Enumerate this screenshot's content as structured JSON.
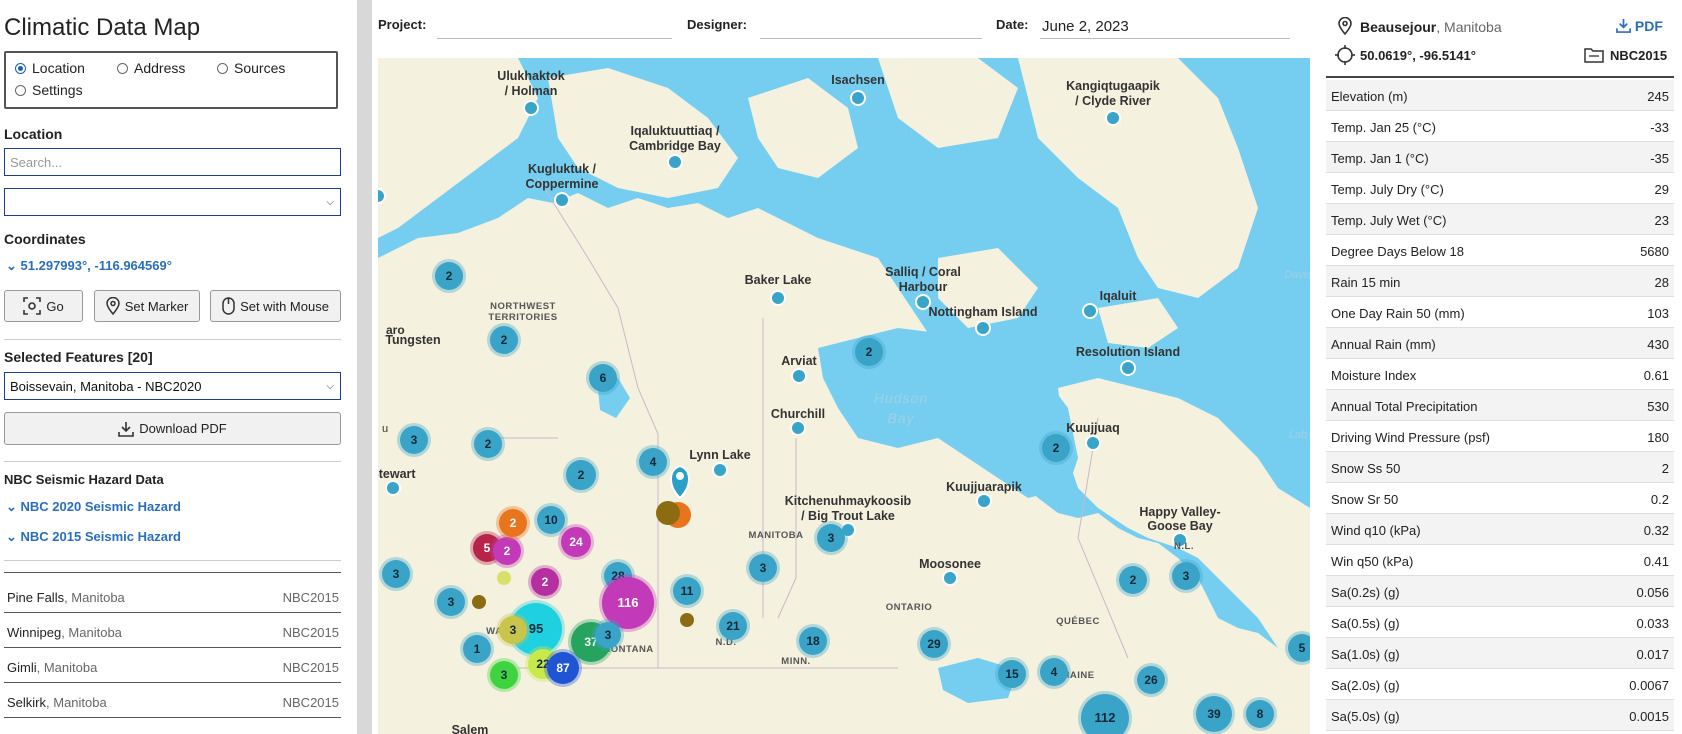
{
  "app_title": "Climatic Data Map",
  "modes": [
    {
      "label": "Location",
      "selected": true
    },
    {
      "label": "Address",
      "selected": false
    },
    {
      "label": "Sources",
      "selected": false
    },
    {
      "label": "Settings",
      "selected": false
    }
  ],
  "location_label": "Location",
  "search_placeholder": "Search...",
  "location_select_value": "",
  "coordinates_label": "Coordinates",
  "coordinates_value": "51.297993°, -116.964569°",
  "buttons": {
    "go": "Go",
    "set_marker": "Set Marker",
    "set_mouse": "Set with Mouse",
    "download_pdf": "Download PDF"
  },
  "selected_features_label": "Selected Features [20]",
  "selected_feature_value": "Boissevain, Manitoba - NBC2020",
  "seismic_label": "NBC Seismic Hazard Data",
  "seismic_links": [
    "NBC 2020 Seismic Hazard",
    "NBC 2015 Seismic Hazard"
  ],
  "feature_list": [
    {
      "name": "Pine Falls",
      "prov": ", Manitoba",
      "code": "NBC2015"
    },
    {
      "name": "Winnipeg",
      "prov": ", Manitoba",
      "code": "NBC2015"
    },
    {
      "name": "Gimli",
      "prov": ", Manitoba",
      "code": "NBC2015"
    },
    {
      "name": "Selkirk",
      "prov": ", Manitoba",
      "code": "NBC2015"
    }
  ],
  "header": {
    "project": "Project:",
    "designer": "Designer:",
    "date_label": "Date:",
    "date_value": "June 2, 2023"
  },
  "right": {
    "place_name": "Beausejour",
    "place_prov": ", Manitoba",
    "pdf": "PDF",
    "coords": "50.0619°, -96.5141°",
    "code": "NBC2015",
    "rows": [
      {
        "k": "Elevation (m)",
        "v": "245"
      },
      {
        "k": "Temp. Jan 25 (°C)",
        "v": "-33"
      },
      {
        "k": "Temp. Jan 1 (°C)",
        "v": "-35"
      },
      {
        "k": "Temp. July Dry (°C)",
        "v": "29"
      },
      {
        "k": "Temp. July Wet (°C)",
        "v": "23"
      },
      {
        "k": "Degree Days Below 18",
        "v": "5680"
      },
      {
        "k": "Rain 15 min",
        "v": "28"
      },
      {
        "k": "One Day Rain 50 (mm)",
        "v": "103"
      },
      {
        "k": "Annual Rain (mm)",
        "v": "430"
      },
      {
        "k": "Moisture Index",
        "v": "0.61"
      },
      {
        "k": "Annual Total Precipitation",
        "v": "530"
      },
      {
        "k": "Driving Wind Pressure (psf)",
        "v": "180"
      },
      {
        "k": "Snow Ss 50",
        "v": "2"
      },
      {
        "k": "Snow Sr 50",
        "v": "0.2"
      },
      {
        "k": "Wind q10 (kPa)",
        "v": "0.32"
      },
      {
        "k": "Win q50 (kPa)",
        "v": "0.41"
      },
      {
        "k": "Sa(0.2s) (g)",
        "v": "0.056"
      },
      {
        "k": "Sa(0.5s) (g)",
        "v": "0.033"
      },
      {
        "k": "Sa(1.0s) (g)",
        "v": "0.017"
      },
      {
        "k": "Sa(2.0s) (g)",
        "v": "0.0067"
      },
      {
        "k": "Sa(5.0s) (g)",
        "v": "0.0015"
      }
    ]
  },
  "map": {
    "places": [
      "Ulukhaktok",
      "/ Holman",
      "Isachsen",
      "Kangiqtugaapik",
      "/ Clyde River",
      "Iqaluktuuttiaq /",
      "Cambridge Bay",
      "Kugluktuk /",
      "Coppermine",
      "Baker Lake",
      "Salliq / Coral",
      "Harbour",
      "Nottingham Island",
      "Iqaluit",
      "Resolution Island",
      "Tungsten",
      "Arviat",
      "Churchill",
      "Kuujjuaq",
      "Lynn Lake",
      "Stewart",
      "Kitchenuhmaykoosib",
      "/ Big Trout Lake",
      "Kuujjuarapik",
      "Happy Valley-",
      "Goose Bay",
      "Moosonee",
      "Salem"
    ],
    "regions": [
      "NORTHWEST",
      "TERRITORIES",
      "MANITOBA",
      "ONTARIO",
      "QUÉBEC",
      "MONTANA",
      "N.D.",
      "MINN.",
      "WASH.",
      "MAINE",
      "N.L."
    ],
    "water": [
      "Hudson",
      "Bay"
    ],
    "edge_fragments": [
      "aro",
      "u",
      "Davis",
      "Lab"
    ],
    "clusters": [
      {
        "n": "2"
      },
      {
        "n": "2"
      },
      {
        "n": "6"
      },
      {
        "n": "3"
      },
      {
        "n": "2"
      },
      {
        "n": "2"
      },
      {
        "n": "4"
      },
      {
        "n": "2"
      },
      {
        "n": "2"
      },
      {
        "n": "10"
      },
      {
        "n": "24"
      },
      {
        "n": "5"
      },
      {
        "n": "2"
      },
      {
        "n": "28"
      },
      {
        "n": "116"
      },
      {
        "n": "2"
      },
      {
        "n": "11"
      },
      {
        "n": "3"
      },
      {
        "n": "3"
      },
      {
        "n": "3"
      },
      {
        "n": "21"
      },
      {
        "n": "18"
      },
      {
        "n": "29"
      },
      {
        "n": "15"
      },
      {
        "n": "4"
      },
      {
        "n": "26"
      },
      {
        "n": "112"
      },
      {
        "n": "39"
      },
      {
        "n": "8"
      },
      {
        "n": "5"
      },
      {
        "n": "2"
      },
      {
        "n": "3"
      },
      {
        "n": "2"
      },
      {
        "n": "3"
      },
      {
        "n": "95"
      },
      {
        "n": "37"
      },
      {
        "n": "22"
      },
      {
        "n": "87"
      },
      {
        "n": "3"
      },
      {
        "n": "3"
      },
      {
        "n": "1"
      },
      {
        "n": "3"
      }
    ]
  },
  "colors": {
    "accent": "#2a6ebb",
    "cluster": "#3aa3c8",
    "water": "#75cef0",
    "land": "#f4f1df"
  }
}
